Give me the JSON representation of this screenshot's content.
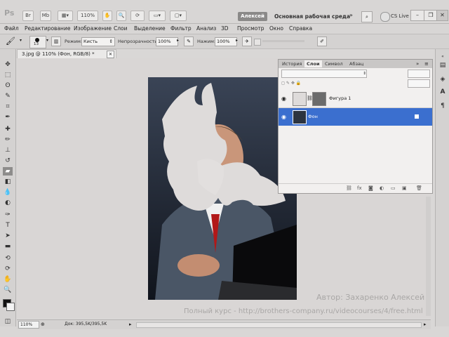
{
  "app": {
    "logo": "Ps",
    "zoom_box": "110%",
    "user": "Алексей",
    "workspace": "Основная рабочая среда",
    "cs_live": "CS Live"
  },
  "menu": [
    "Файл",
    "Редактирование",
    "Изображение",
    "Слои",
    "Выделение",
    "Фильтр",
    "Анализ",
    "3D",
    "Просмотр",
    "Окно",
    "Справка"
  ],
  "options": {
    "brush_size": "13",
    "mode_label": "Режим:",
    "mode_value": "Кисть",
    "opacity_label": "Непрозрачность:",
    "opacity_value": "100%",
    "pressure_label": "Нажим:",
    "pressure_value": "100%"
  },
  "document": {
    "tab_title": "3.jpg @ 110% (Фон, RGB/8) *"
  },
  "panel": {
    "tabs": [
      "История",
      "Слои",
      "Символ",
      "Абзац"
    ],
    "active_tab": 1,
    "layers": [
      {
        "name": "Фигура 1",
        "selected": false
      },
      {
        "name": "Фон",
        "selected": true
      }
    ]
  },
  "status": {
    "zoom": "110%",
    "doc_info": "Док: 395,5K/395,5K"
  },
  "watermark": {
    "author": "Автор: Захаренко Алексей",
    "course": "Полный курс - http://brothers-company.ru/videocourses/4/free.html"
  },
  "colors": {
    "selection": "#3b6fcf",
    "app_bg": "#d8d6d5",
    "canvas_bg": "#d9d6d5"
  }
}
